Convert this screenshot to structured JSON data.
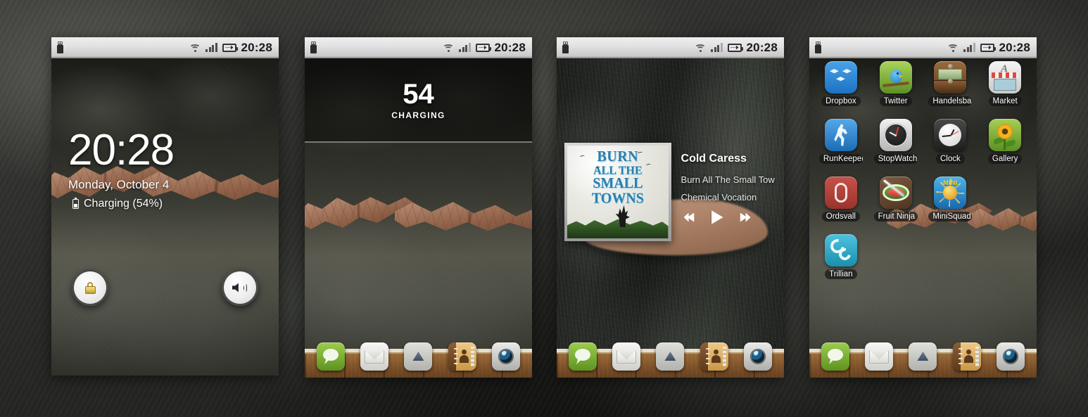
{
  "statusbar": {
    "time": "20:28",
    "icons": [
      "usb-icon",
      "wifi-icon",
      "signal-icon",
      "battery-charging-icon"
    ]
  },
  "screen1": {
    "name": "lockscreen",
    "clock": "20:28",
    "date": "Monday, October 4",
    "battery_status": "Charging (54%)",
    "buttons": [
      {
        "name": "unlock-button",
        "icon": "padlock-icon"
      },
      {
        "name": "sound-toggle-button",
        "icon": "speaker-icon"
      }
    ]
  },
  "screen2": {
    "name": "homescreen-battery-widget",
    "battery_percent": "54",
    "battery_label": "CHARGING"
  },
  "screen3": {
    "name": "homescreen-music-widget",
    "album_art_lines": [
      "BURN",
      "ALL THE",
      "SMALL",
      "TOWNS"
    ],
    "track_title": "Cold Caress",
    "artist": "Burn All The Small Tow",
    "album": "Chemical Vocation",
    "controls": [
      {
        "name": "previous-track-button",
        "icon": "skip-previous-icon"
      },
      {
        "name": "play-button",
        "icon": "play-icon"
      },
      {
        "name": "next-track-button",
        "icon": "skip-next-icon"
      }
    ]
  },
  "screen4": {
    "name": "app-drawer",
    "apps": [
      {
        "label": "Dropbox",
        "icon": "dropbox-icon"
      },
      {
        "label": "Twitter",
        "icon": "twitter-icon"
      },
      {
        "label": "Handelsba",
        "icon": "handelsbanken-icon"
      },
      {
        "label": "Market",
        "icon": "market-icon"
      },
      {
        "label": "RunKeeper",
        "icon": "runkeeper-icon"
      },
      {
        "label": "StopWatch",
        "icon": "stopwatch-icon"
      },
      {
        "label": "Clock",
        "icon": "clock-icon"
      },
      {
        "label": "Gallery",
        "icon": "gallery-icon"
      },
      {
        "label": "Ordsvall",
        "icon": "ordsvall-icon"
      },
      {
        "label": "Fruit Ninja",
        "icon": "fruit-ninja-icon"
      },
      {
        "label": "MiniSquad",
        "icon": "minisquadron-icon"
      },
      {
        "label": "Trillian",
        "icon": "trillian-icon"
      }
    ],
    "minisquadron_art_text": "MINI"
  },
  "dock": {
    "items": [
      {
        "name": "messaging",
        "icon": "speech-bubble-icon"
      },
      {
        "name": "email",
        "icon": "envelope-icon"
      },
      {
        "name": "app-drawer",
        "icon": "triangle-up-icon"
      },
      {
        "name": "contacts",
        "icon": "address-book-icon"
      },
      {
        "name": "camera",
        "icon": "camera-lens-icon"
      }
    ]
  },
  "colors": {
    "statusbar_bg": "#e2e2e2",
    "dock_wood": "#7e5129",
    "accent_green": "#9ccd4e",
    "dropbox_blue": "#1c72c4",
    "album_blue": "#2b7fae"
  }
}
